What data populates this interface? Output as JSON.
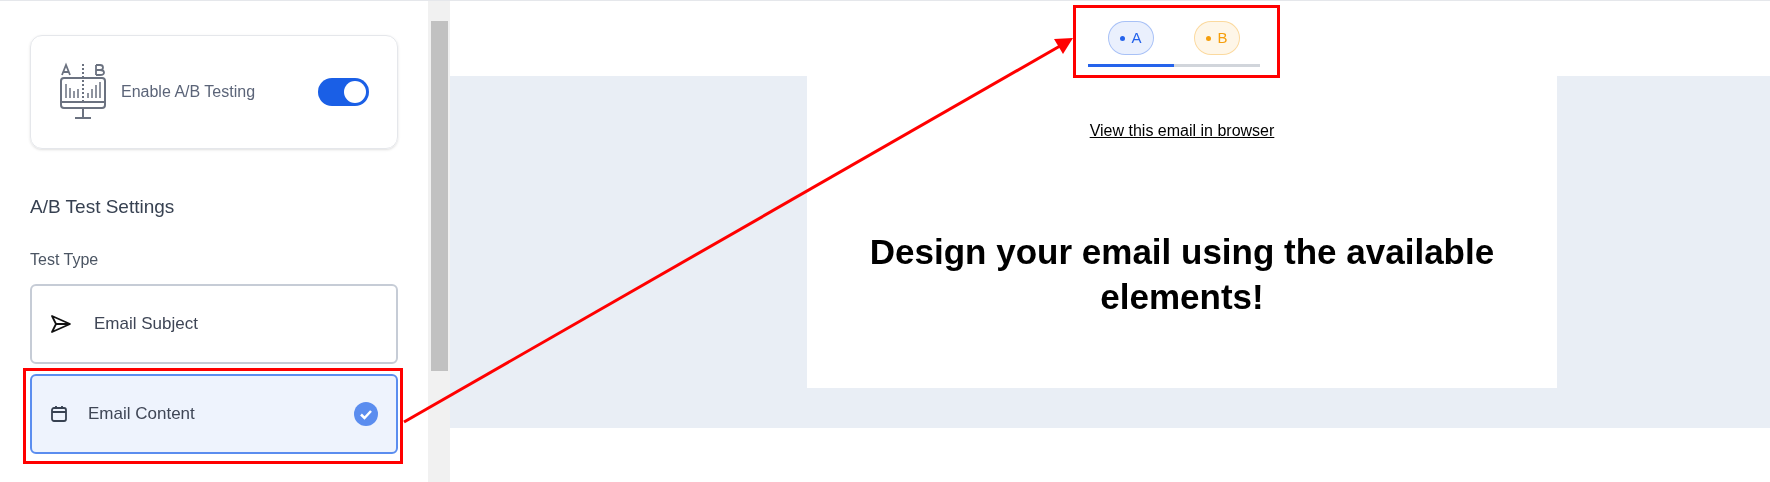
{
  "sidebar": {
    "ab_toggle": {
      "label": "Enable A/B Testing",
      "on": true
    },
    "section_title": "A/B Test Settings",
    "test_type": {
      "label": "Test Type",
      "options": [
        {
          "label": "Email Subject",
          "kind": "subject",
          "selected": false
        },
        {
          "label": "Email Content",
          "kind": "content",
          "selected": true
        }
      ]
    }
  },
  "variants": [
    {
      "label": "A",
      "selected": true,
      "color": "#2563eb"
    },
    {
      "label": "B",
      "selected": false,
      "color": "#f59e0b"
    }
  ],
  "email": {
    "browser_link": "View this email in browser",
    "heading": "Design your email using the available elements!"
  }
}
